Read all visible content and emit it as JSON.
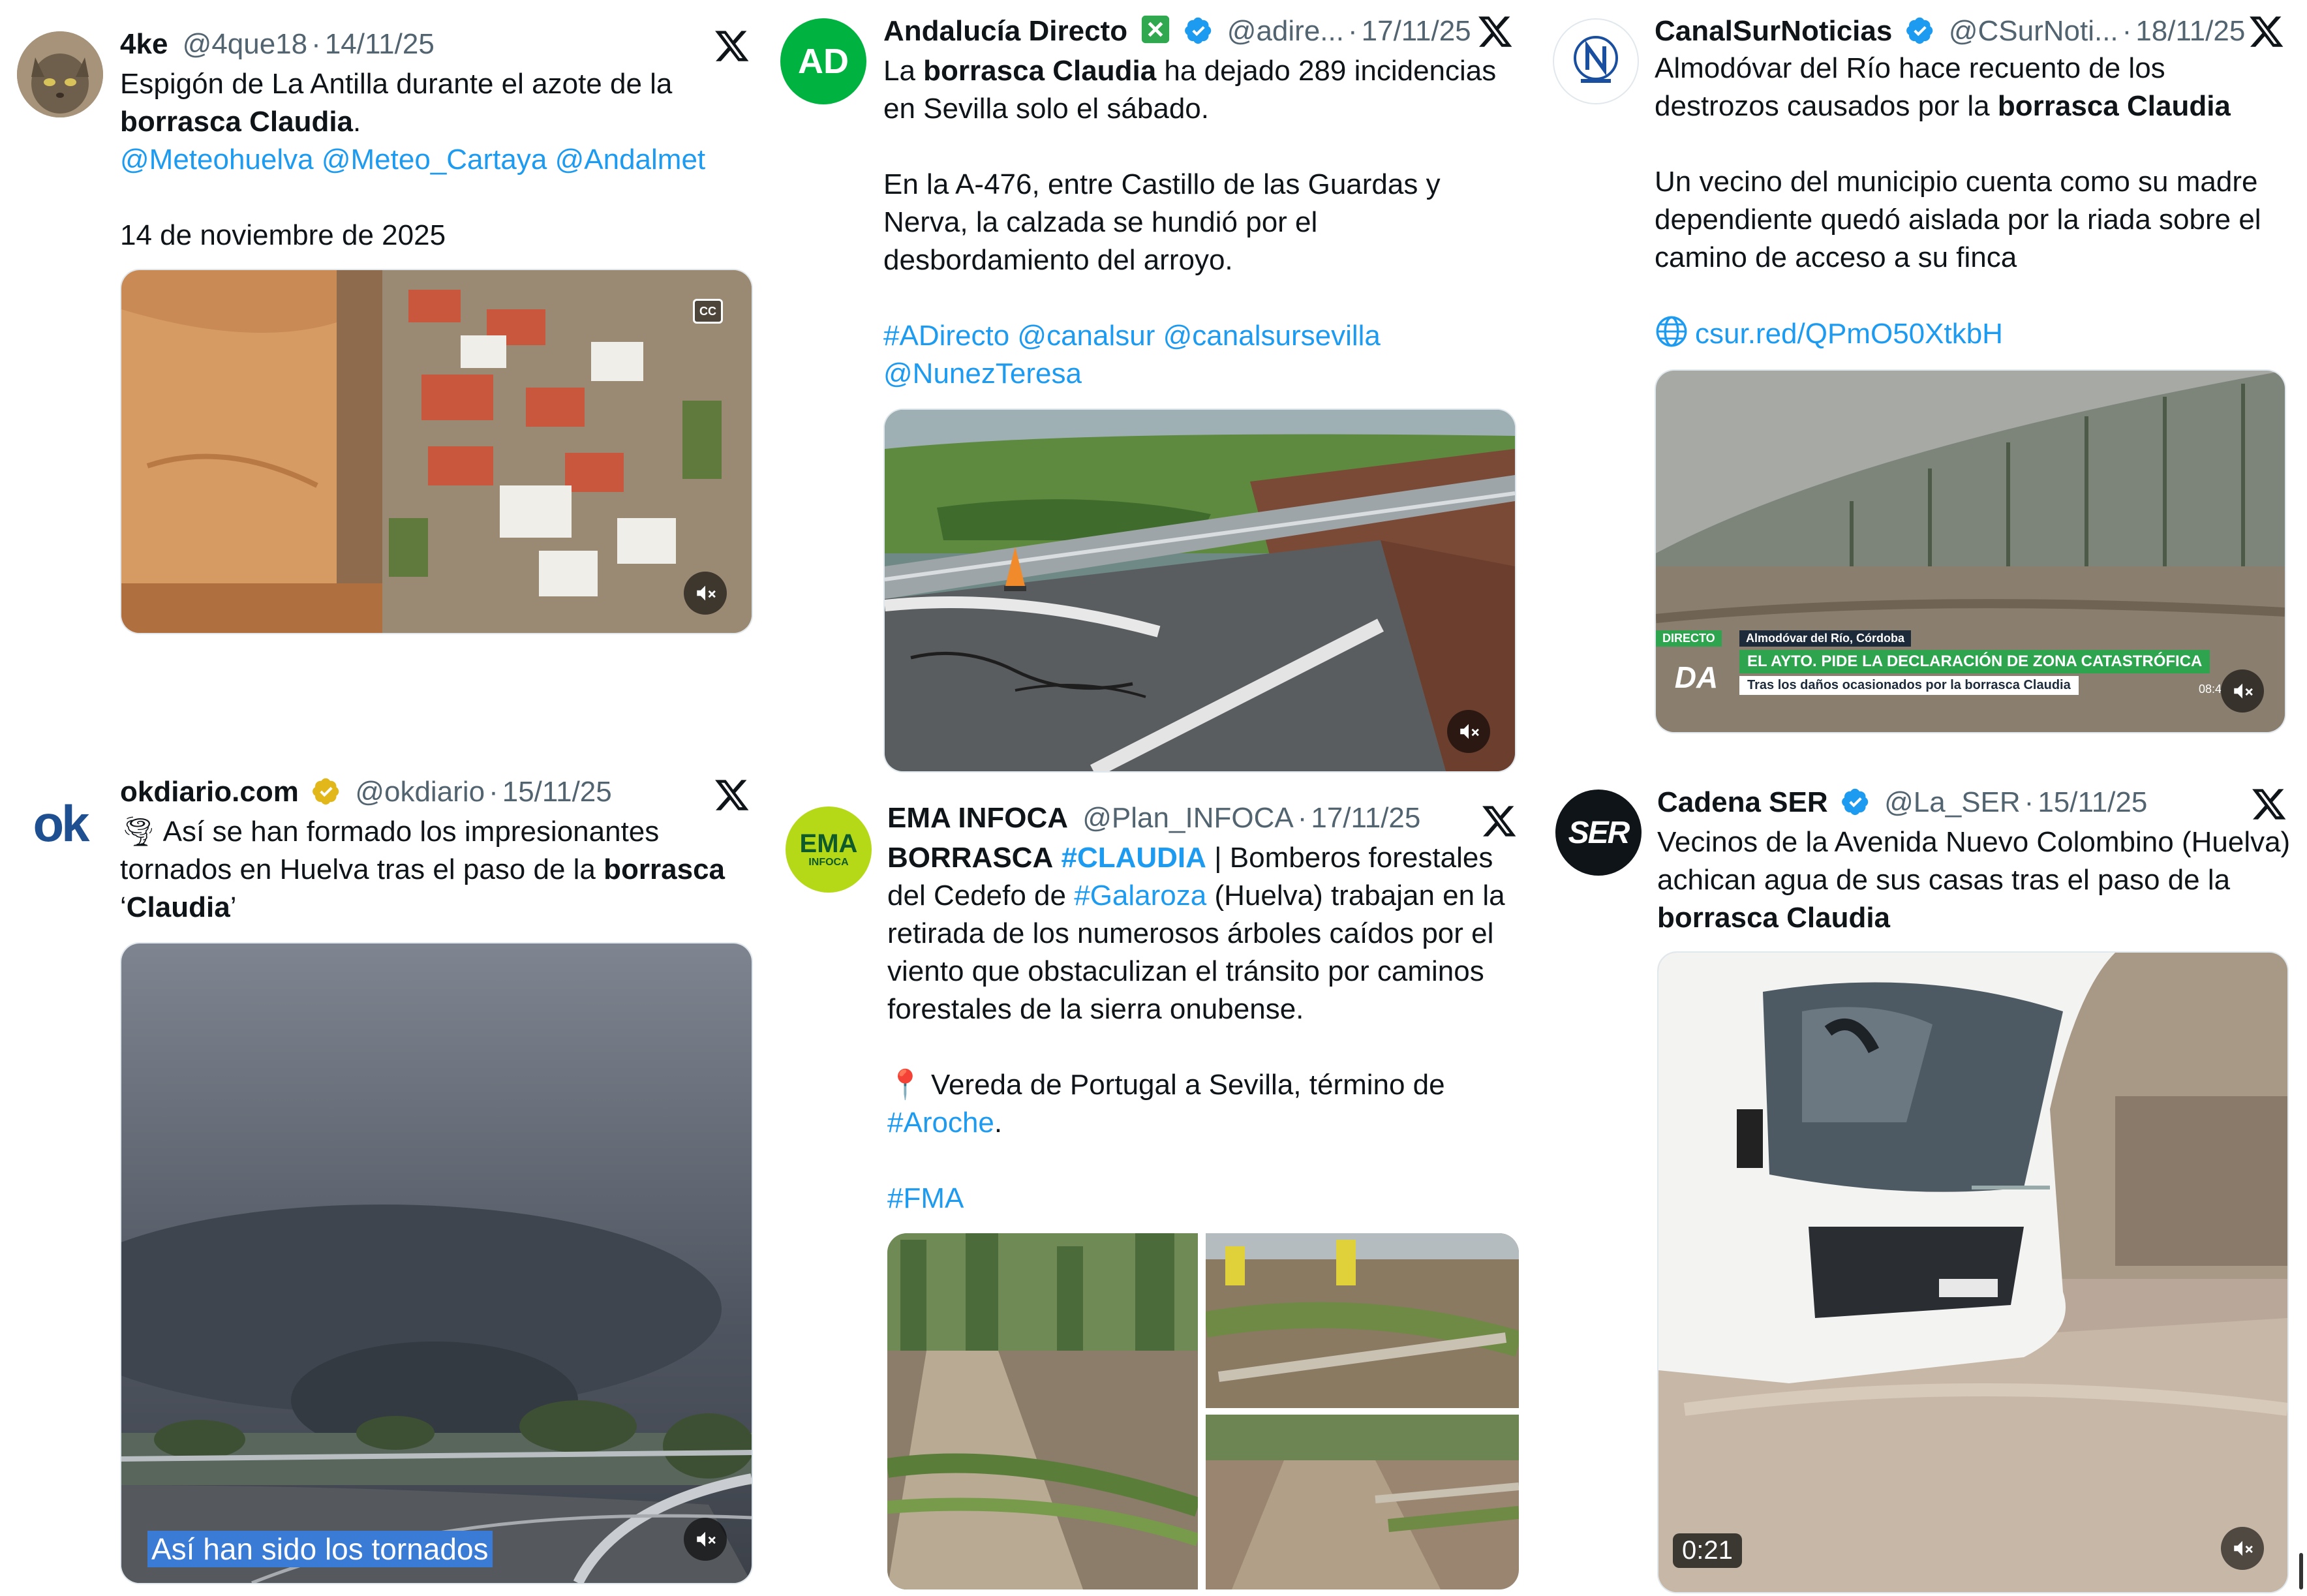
{
  "tweets": [
    {
      "name": "4ke",
      "handle": "@4que18",
      "date": "14/11/25",
      "text_start": "Espigón de La Antilla durante el azote de la ",
      "text_bold": "borrasca Claudia",
      "text_end": ".",
      "mentions": [
        "@Meteohuelva",
        "@Meteo_Cartaya",
        "@Andalmet"
      ],
      "date_line": "14 de noviembre de 2025",
      "media_cc": "CC"
    },
    {
      "name": "Andalucía Directo",
      "handle": "@adire...",
      "date": "17/11/25",
      "avatar_text": "AD",
      "text_p1_start": "La ",
      "text_p1_bold": "borrasca Claudia",
      "text_p1_end": " ha dejado 289 incidencias en Sevilla solo el sábado.",
      "text_p2": "En la A-476, entre Castillo de las Guardas y Nerva, la calzada se hundió por el desbordamiento del arroyo.",
      "hashtags": [
        "#ADirecto",
        "@canalsur",
        "@canalsursevilla",
        "@NunezTeresa"
      ]
    },
    {
      "name": "CanalSurNoticias",
      "handle": "@CSurNoti...",
      "date": "18/11/25",
      "text_p1_start": "Almodóvar del Río hace recuento de los destrozos causados por la ",
      "text_p1_bold": "borrasca Claudia",
      "text_p2": "Un vecino del municipio cuenta como su madre dependiente quedó aislada por la riada sobre el camino de acceso a su finca",
      "link": "csur.red/QPmO50XtkbH",
      "lower_third": {
        "live": "DIRECTO",
        "place": "Almodóvar del Río, Córdoba",
        "headline": "EL AYTO. PIDE LA DECLARACIÓN DE ZONA CATASTRÓFICA",
        "sub": "Tras los daños ocasionados por la borrasca Claudia",
        "logo": "DA",
        "clock": "08:4"
      }
    },
    {
      "name": "okdiario.com",
      "handle": "@okdiario",
      "date": "15/11/25",
      "avatar_text": "ok",
      "emoji": "🌪",
      "text_start": " Así se han formado los impresionantes tornados en Huelva tras el paso de la ",
      "text_bold1": "borrasca",
      "text_mid": " ‘",
      "text_bold2": "Claudia",
      "text_end": "’",
      "caption": "Así han sido los tornados"
    },
    {
      "name": "EMA INFOCA",
      "handle": "@Plan_INFOCA",
      "date": "17/11/25",
      "avatar_text": "EMA",
      "avatar_sub": "INFOCA",
      "text_bold": "BORRASCA",
      "tag1": "#CLAUDIA",
      "text_a": " | Bomberos forestales del Cedefo de ",
      "tag2": "#Galaroza",
      "text_b": " (Huelva) trabajan en la retirada de los numerosos árboles caídos por el viento que obstaculizan el tránsito por caminos forestales de la sierra onubense.",
      "pin": "📍",
      "text_c": " Vereda de Portugal a Sevilla, término de ",
      "tag3": "#Aroche",
      "text_d": ".",
      "tag4": "#FMA"
    },
    {
      "name": "Cadena SER",
      "handle": "@La_SER",
      "date": "15/11/25",
      "avatar_text": "SER",
      "text_start": "Vecinos de la Avenida Nuevo Colombino (Huelva) achican agua de sus casas tras el paso de la ",
      "text_bold": "borrasca Claudia",
      "duration": "0:21"
    }
  ],
  "colors": {
    "text": "#0f1419",
    "muted": "#536471",
    "link": "#1d9bf0",
    "verified_blue": "#1d9bf0",
    "verified_gold": "#e2b719",
    "ad_green": "#00b341",
    "ema_green": "#b5d916"
  }
}
